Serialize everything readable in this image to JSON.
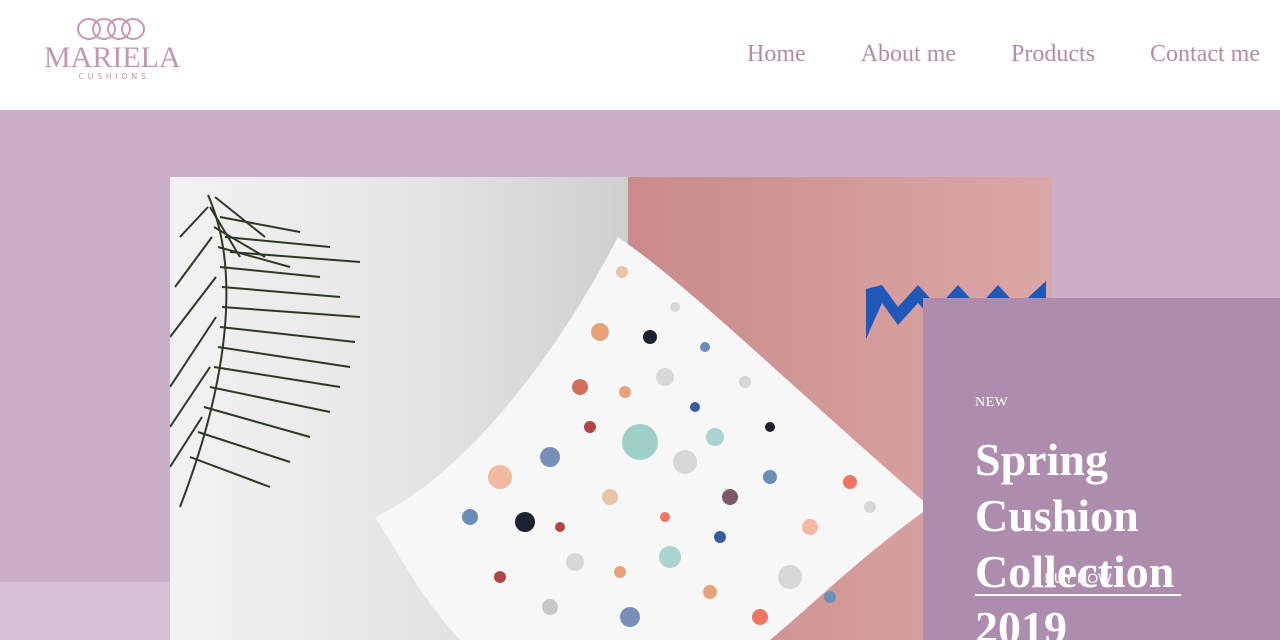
{
  "brand": {
    "name": "MARIELA",
    "tagline": "CUSHIONS",
    "color": "#c396b8"
  },
  "nav": {
    "items": [
      {
        "label": "Home"
      },
      {
        "label": "About me"
      },
      {
        "label": "Products"
      },
      {
        "label": "Contact me"
      }
    ]
  },
  "hero": {
    "background": "#cbaec8",
    "tag": "NEW",
    "title": "Spring Cushion Collection 2019",
    "button_label": "BUY NOW",
    "panel_color": "#ae8cad"
  },
  "icons": [
    "infinity-logo-icon",
    "palm-leaf-graphic",
    "terrazzo-cushion-graphic",
    "blue-zigzag-graphic"
  ]
}
